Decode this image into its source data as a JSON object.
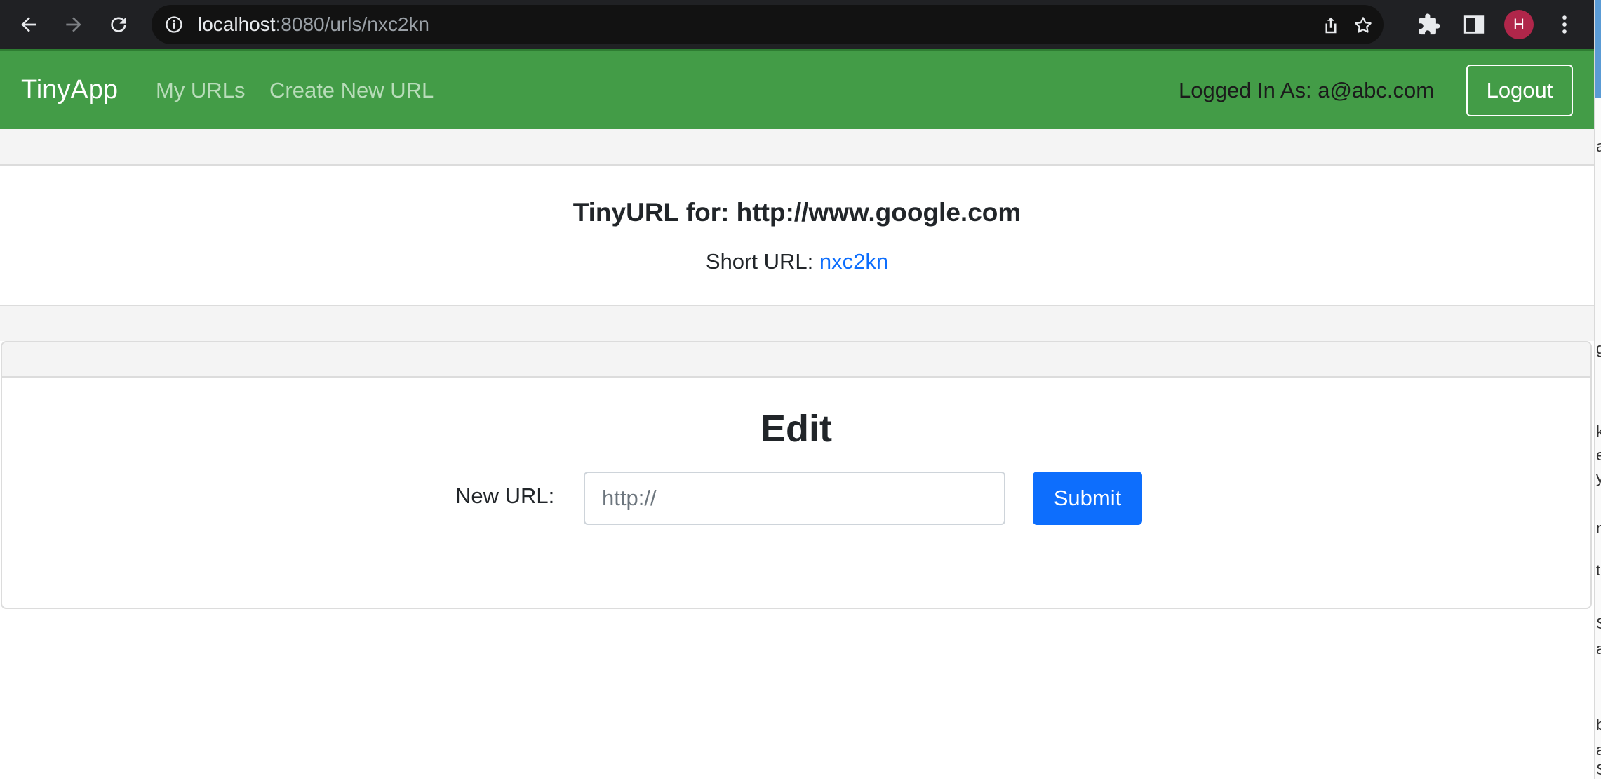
{
  "browser": {
    "url_host": "localhost",
    "url_rest": ":8080/urls/nxc2kn",
    "profile_initial": "H",
    "profile_color": "#b0264a",
    "icons": [
      "back-arrow-icon",
      "forward-arrow-icon",
      "reload-icon",
      "site-info-icon",
      "share-icon",
      "bookmark-star-icon",
      "extensions-puzzle-icon",
      "side-panel-icon",
      "kebab-menu-icon"
    ]
  },
  "navbar": {
    "brand": "TinyApp",
    "links": [
      "My URLs",
      "Create New URL"
    ],
    "logged_in_text": "Logged In As: a@abc.com",
    "logout_label": "Logout",
    "background_color": "#439c47"
  },
  "info_card": {
    "title": "TinyURL for: http://www.google.com",
    "short_url_label": "Short URL:",
    "short_url_value": "nxc2kn"
  },
  "edit_card": {
    "title": "Edit",
    "new_url_label": "New URL:",
    "input_placeholder": "http://",
    "input_value": "",
    "submit_label": "Submit",
    "submit_color": "#0d6efd"
  },
  "edge_strip": {
    "visible_chars": [
      "a",
      "g",
      "k",
      "e",
      "y",
      "n",
      "t",
      "S",
      "a",
      "b",
      "a",
      "S"
    ]
  }
}
